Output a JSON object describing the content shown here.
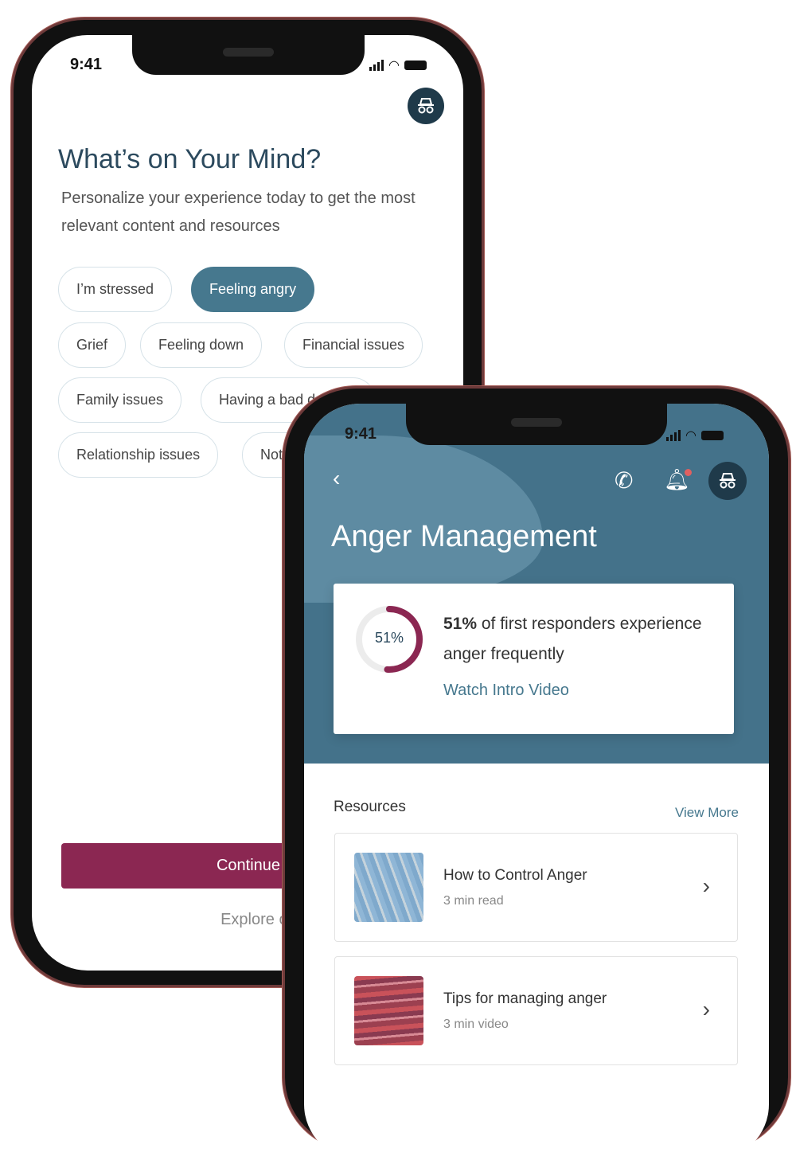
{
  "back_phone": {
    "status": {
      "time": "9:41"
    },
    "title": "What’s on Your Mind?",
    "subtitle": "Personalize your experience today to get the most relevant content and resources",
    "chips": [
      {
        "label": "I’m stressed",
        "selected": false
      },
      {
        "label": "Feeling angry",
        "selected": true
      },
      {
        "label": "Grief",
        "selected": false
      },
      {
        "label": "Feeling down",
        "selected": false
      },
      {
        "label": "Financial issues",
        "selected": false
      },
      {
        "label": "Family issues",
        "selected": false
      },
      {
        "label": "Having a bad d",
        "selected": false
      },
      {
        "label": "Relationship issues",
        "selected": false
      },
      {
        "label": "Not",
        "selected": false
      }
    ],
    "continue_label": "Continue",
    "explore_label": "Explore on my"
  },
  "front_phone": {
    "status": {
      "time": "9:41"
    },
    "title": "Anger Management",
    "stat": {
      "percent_label": "51%",
      "percent_value": 51,
      "bold": "51%",
      "text": " of first responders experience anger frequently",
      "link": "Watch Intro Video"
    },
    "resources": {
      "heading": "Resources",
      "view_more": "View More",
      "items": [
        {
          "title": "How to Control Anger",
          "meta": "3 min read"
        },
        {
          "title": "Tips for managing anger",
          "meta": "3 min video"
        }
      ]
    }
  },
  "colors": {
    "teal": "#46788e",
    "accent": "#8b2752",
    "dark": "#1f3a4a",
    "title": "#2c4a5e"
  }
}
